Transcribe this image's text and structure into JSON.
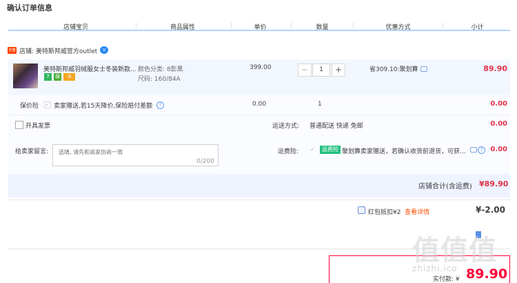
{
  "page": {
    "title": "确认订单信息"
  },
  "columns": [
    "店铺宝贝",
    "商品属性",
    "单价",
    "数量",
    "优惠方式",
    "小计"
  ],
  "shop": {
    "badge": "天猫",
    "label": "店铺: 美特斯邦威官方outlet",
    "info_icon": "v"
  },
  "item": {
    "title": "美特斯邦威羽绒服女士冬装新款...",
    "tags": [
      "7",
      "保",
      "卡"
    ],
    "attr_color": "颜色分类: 8影黑",
    "attr_size": "尺码: 160/84A",
    "price": "399.00",
    "quantity": "1",
    "discount": "省309.10:聚划算",
    "subtotal": "89.90"
  },
  "insurance": {
    "label": "保价险",
    "text": "卖家赠送,若15天降价,保险赔付差额",
    "price": "0.00",
    "quantity": "1",
    "subtotal": "0.00"
  },
  "invoice": {
    "label": "开具发票"
  },
  "shipping": {
    "label": "运送方式:",
    "value": "普通配送 快递 免邮",
    "subtotal": "0.00"
  },
  "message": {
    "label": "给卖家留言:",
    "placeholder": "选填, 请先和商家协商一致",
    "counter": "0/200"
  },
  "freight_insurance": {
    "label": "运费险:",
    "badge": "运费险",
    "text": "聚划算卖家赠送，若确认收货前退货，可获...",
    "subtotal": "0.00"
  },
  "shop_total": {
    "label": "店铺合计(含运费)",
    "value": "¥89.90"
  },
  "coupon": {
    "label": "红包抵扣¥2",
    "link": "查看详情",
    "value": "¥-2.00"
  },
  "payment": {
    "label": "实付款: ¥",
    "value": "89.90"
  },
  "watermark": {
    "logo": "值值值",
    "url": "zhizhi.ico"
  },
  "colors": {
    "accent": "#e0314b",
    "link": "#ff5000",
    "header_line": "#b2d1ff"
  }
}
